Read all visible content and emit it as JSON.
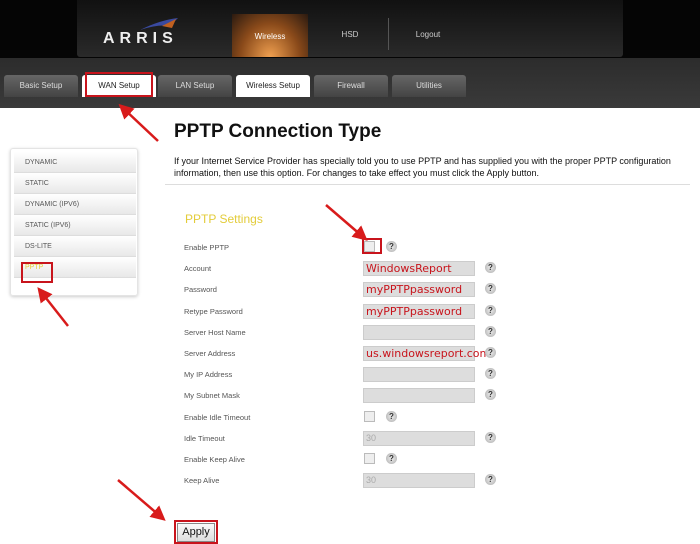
{
  "header": {
    "logo": "ARRIS",
    "nav": [
      "Wireless",
      "HSD",
      "Logout"
    ]
  },
  "tabs": [
    "Basic Setup",
    "WAN Setup",
    "LAN Setup",
    "Wireless Setup",
    "Firewall",
    "Utilities"
  ],
  "sidebar": [
    "DYNAMIC",
    "STATIC",
    "DYNAMIC (IPV6)",
    "STATIC (IPV6)",
    "DS-LITE",
    "PPTP"
  ],
  "main": {
    "title": "PPTP Connection Type",
    "description": "If your Internet Service Provider has specially told you to use PPTP and has supplied you with the proper PPTP configuration information, then use this option. For changes to take effect you must click the Apply button.",
    "section": "PPTP Settings",
    "help": "?",
    "fields": [
      {
        "label": "Enable PPTP",
        "type": "checkbox"
      },
      {
        "label": "Account",
        "type": "text",
        "value": "WindowsReport"
      },
      {
        "label": "Password",
        "type": "text",
        "value": "myPPTPpassword"
      },
      {
        "label": "Retype Password",
        "type": "text",
        "value": "myPPTPpassword"
      },
      {
        "label": "Server Host Name",
        "type": "text",
        "value": ""
      },
      {
        "label": "Server Address",
        "type": "text",
        "value": "us.windowsreport.com"
      },
      {
        "label": "My IP Address",
        "type": "text",
        "value": ""
      },
      {
        "label": "My Subnet Mask",
        "type": "text",
        "value": ""
      },
      {
        "label": "Enable Idle Timeout",
        "type": "checkbox"
      },
      {
        "label": "Idle Timeout",
        "type": "disabled",
        "value": "30"
      },
      {
        "label": "Enable Keep Alive",
        "type": "checkbox"
      },
      {
        "label": "Keep Alive",
        "type": "disabled",
        "value": "30"
      }
    ],
    "apply": "Apply"
  },
  "colors": {
    "accent": "#e3cc3a",
    "highlight": "#c8141c"
  }
}
